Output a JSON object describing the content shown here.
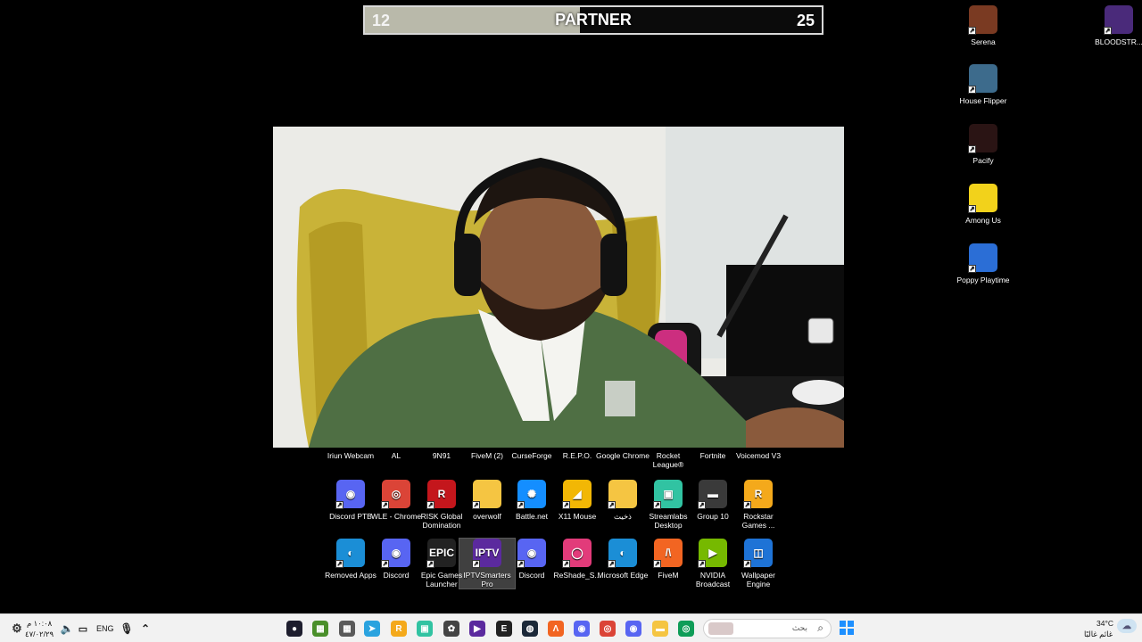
{
  "scorebar": {
    "left_score": "12",
    "title": "PARTNER",
    "right_score": "25",
    "progress": 0.47
  },
  "desktop_right": [
    {
      "label": "Serena",
      "icon": "game-art-icon",
      "color": "#7a3a22"
    },
    {
      "label": "House Flipper",
      "icon": "game-art-icon",
      "color": "#3d6b8c"
    },
    {
      "label": "Pacify",
      "icon": "game-art-icon",
      "color": "#2a1414"
    },
    {
      "label": "Among Us",
      "icon": "among-us-icon",
      "color": "#f2d21b"
    },
    {
      "label": "Poppy Playtime",
      "icon": "poppy-icon",
      "color": "#2b6ed6"
    }
  ],
  "desktop_far_right": [
    {
      "label": "BLOODSTR...",
      "icon": "game-art-icon",
      "color": "#4a2a7a"
    }
  ],
  "desktop_row1": [
    "Iriun Webcam",
    "AL",
    "9N91",
    "FiveM (2)",
    "CurseForge",
    "R.E.P.O.",
    "Google Chrome",
    "Rocket League®",
    "Fortnite",
    "Voicemod V3"
  ],
  "desktop_row2": [
    {
      "label": "Discord PTB",
      "icon": "discord-icon",
      "color": "#5865f2",
      "glyph": "◉"
    },
    {
      "label": "WLE - Chrome",
      "icon": "chrome-icon",
      "color": "#db4437",
      "glyph": "◎"
    },
    {
      "label": "RISK Global Domination",
      "icon": "risk-icon",
      "color": "#c4161c",
      "glyph": "R"
    },
    {
      "label": "overwolf",
      "icon": "folder-icon",
      "color": "#f5c542",
      "glyph": ""
    },
    {
      "label": "Battle.net",
      "icon": "battlenet-icon",
      "color": "#148eff",
      "glyph": "✺"
    },
    {
      "label": "X11 Mouse",
      "icon": "mouse-icon",
      "color": "#f2b705",
      "glyph": "◢"
    },
    {
      "label": "ذخيث",
      "icon": "folder-icon",
      "color": "#f5c542",
      "glyph": ""
    },
    {
      "label": "Streamlabs Desktop",
      "icon": "streamlabs-icon",
      "color": "#31c3a2",
      "glyph": "▣"
    },
    {
      "label": "Group 10",
      "icon": "group-icon",
      "color": "#3a3a3a",
      "glyph": "▬"
    },
    {
      "label": "Rockstar Games ...",
      "icon": "rockstar-icon",
      "color": "#f4a91b",
      "glyph": "R"
    }
  ],
  "desktop_row3": [
    {
      "label": "Removed Apps",
      "icon": "edge-icon",
      "color": "#1b8ed6",
      "glyph": "◐"
    },
    {
      "label": "Discord",
      "icon": "discord-icon",
      "color": "#5865f2",
      "glyph": "◉"
    },
    {
      "label": "Epic Games Launcher",
      "icon": "epic-icon",
      "color": "#222222",
      "glyph": "EPIC"
    },
    {
      "label": "IPTVSmarters Pro",
      "icon": "iptv-icon",
      "color": "#5b2a9e",
      "glyph": "IPTV"
    },
    {
      "label": "Discord",
      "icon": "discord-icon",
      "color": "#5865f2",
      "glyph": "◉"
    },
    {
      "label": "ReShade_S...",
      "icon": "reshade-icon",
      "color": "#e23b7a",
      "glyph": "◯"
    },
    {
      "label": "Microsoft Edge",
      "icon": "edge-icon",
      "color": "#1b8ed6",
      "glyph": "◐"
    },
    {
      "label": "FiveM",
      "icon": "fivem-icon",
      "color": "#f26522",
      "glyph": "/\\"
    },
    {
      "label": "NVIDIA Broadcast",
      "icon": "nvidia-icon",
      "color": "#76b900",
      "glyph": "▶"
    },
    {
      "label": "Wallpaper Engine",
      "icon": "wallpaper-engine-icon",
      "color": "#1e73d6",
      "glyph": "◫"
    }
  ],
  "taskbar": {
    "time": "١٠:٠٨ م",
    "date": "٤٧/٠٢/٢٩",
    "lang": "ENG",
    "search_placeholder": "بحث",
    "weather_temp": "34°C",
    "weather_desc": "غائم غالبًا",
    "apps": [
      {
        "name": "obs-icon",
        "color": "#1e1e2e",
        "glyph": "●"
      },
      {
        "name": "minecraft-icon",
        "color": "#4a8f2a",
        "glyph": "▦"
      },
      {
        "name": "minecraft-alt-icon",
        "color": "#5a5a5a",
        "glyph": "▦"
      },
      {
        "name": "telegram-icon",
        "color": "#2aa3df",
        "glyph": "➤"
      },
      {
        "name": "rockstar-icon",
        "color": "#f4a91b",
        "glyph": "R"
      },
      {
        "name": "streamlabs-icon",
        "color": "#31c3a2",
        "glyph": "▣"
      },
      {
        "name": "chatgpt-icon",
        "color": "#444",
        "glyph": "✿"
      },
      {
        "name": "iptv-icon",
        "color": "#5b2a9e",
        "glyph": "▶"
      },
      {
        "name": "epic-icon",
        "color": "#222",
        "glyph": "E"
      },
      {
        "name": "steam-icon",
        "color": "#1b2838",
        "glyph": "◍"
      },
      {
        "name": "fivem-icon",
        "color": "#f26522",
        "glyph": "Λ"
      },
      {
        "name": "discord-icon",
        "color": "#5865f2",
        "glyph": "◉"
      },
      {
        "name": "chrome-icon",
        "color": "#db4437",
        "glyph": "◎"
      },
      {
        "name": "discord-ptb-icon",
        "color": "#5865f2",
        "glyph": "◉"
      },
      {
        "name": "file-explorer-icon",
        "color": "#f5c542",
        "glyph": "▬"
      },
      {
        "name": "chrome-alt-icon",
        "color": "#0f9d58",
        "glyph": "◎"
      }
    ]
  }
}
